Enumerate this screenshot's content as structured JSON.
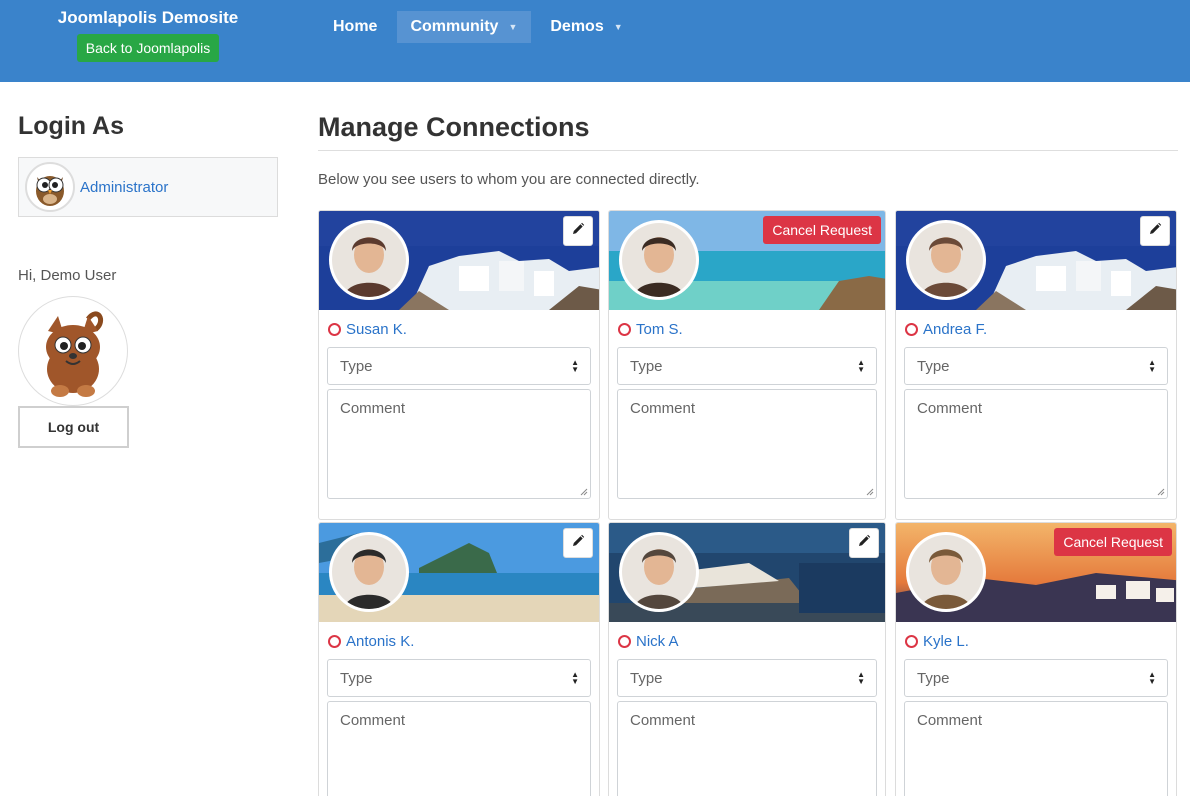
{
  "header": {
    "brand_title": "Joomlapolis Demosite",
    "back_button": "Back to Joomlapolis",
    "nav": [
      {
        "label": "Home",
        "dropdown": false,
        "active": false
      },
      {
        "label": "Community",
        "dropdown": true,
        "active": true
      },
      {
        "label": "Demos",
        "dropdown": true,
        "active": false
      }
    ]
  },
  "sidebar": {
    "title": "Login As",
    "login_user": "Administrator",
    "greeting": "Hi, Demo User",
    "logout_label": "Log out"
  },
  "main": {
    "title": "Manage Connections",
    "intro": "Below you see users to whom you are connected directly."
  },
  "connections": [
    {
      "name": "Susan K.",
      "action": "edit",
      "type_placeholder": "Type",
      "comment_placeholder": "Comment",
      "cover": "blue-sea-village",
      "avatar_color": "#5b3a2e"
    },
    {
      "name": "Tom S.",
      "action": "Cancel Request",
      "type_placeholder": "Type",
      "comment_placeholder": "Comment",
      "cover": "beach-turquoise",
      "avatar_color": "#3b2b22"
    },
    {
      "name": "Andrea F.",
      "action": "edit",
      "type_placeholder": "Type",
      "comment_placeholder": "Comment",
      "cover": "blue-sea-village",
      "avatar_color": "#6b4a38"
    },
    {
      "name": "Antonis K.",
      "action": "edit",
      "type_placeholder": "Type",
      "comment_placeholder": "Comment",
      "cover": "sandy-beach",
      "avatar_color": "#2b2b2b"
    },
    {
      "name": "Nick A",
      "action": "edit",
      "type_placeholder": "Type",
      "comment_placeholder": "Comment",
      "cover": "boat-harbor",
      "avatar_color": "#54473d"
    },
    {
      "name": "Kyle L.",
      "action": "Cancel Request",
      "type_placeholder": "Type",
      "comment_placeholder": "Comment",
      "cover": "sunset-village",
      "avatar_color": "#7a5a3a"
    }
  ],
  "colors": {
    "header_bg": "#3a83cb",
    "success": "#28a745",
    "danger": "#dc3545",
    "link": "#2a73c9"
  }
}
